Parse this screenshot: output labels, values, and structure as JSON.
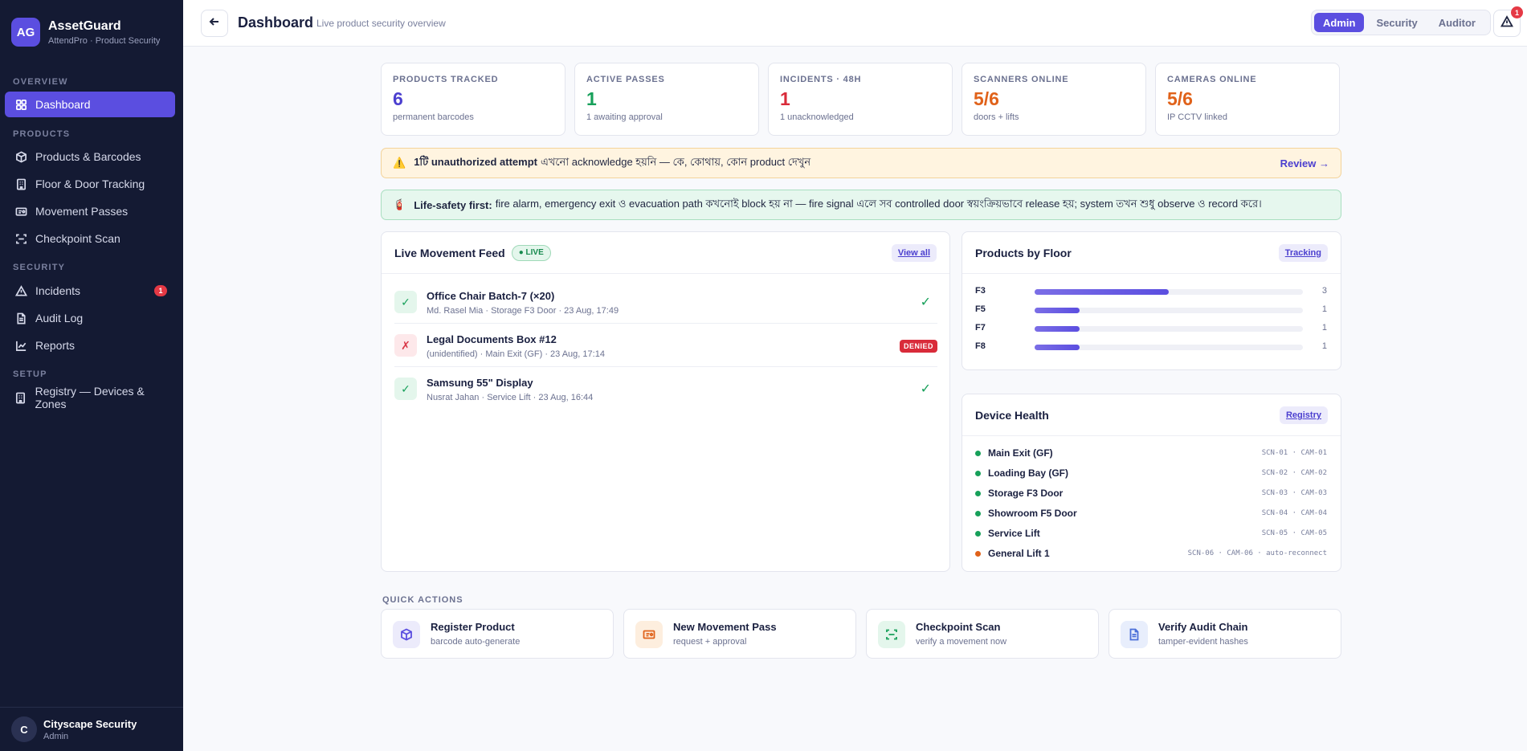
{
  "brand": {
    "logo": "AG",
    "name": "AssetGuard",
    "subtitle": "AttendPro · Product Security"
  },
  "nav": {
    "sections": {
      "overview": "OVERVIEW",
      "products": "PRODUCTS",
      "security": "SECURITY",
      "setup": "SETUP"
    },
    "items": [
      {
        "label": "Dashboard",
        "icon": "grid-icon"
      },
      {
        "label": "Products & Barcodes",
        "icon": "box-icon"
      },
      {
        "label": "Floor & Door Tracking",
        "icon": "building-icon"
      },
      {
        "label": "Movement Passes",
        "icon": "ticket-icon"
      },
      {
        "label": "Checkpoint Scan",
        "icon": "scan-icon"
      },
      {
        "label": "Incidents",
        "icon": "warning-icon",
        "badge": "1"
      },
      {
        "label": "Audit Log",
        "icon": "document-icon"
      },
      {
        "label": "Reports",
        "icon": "chart-icon"
      },
      {
        "label": "Registry — Devices & Zones",
        "icon": "building-icon"
      }
    ]
  },
  "user": {
    "initial": "C",
    "name": "Cityscape Security",
    "role": "Admin"
  },
  "header": {
    "title": "Dashboard",
    "subtitle": "Live product security overview",
    "roles": [
      "Admin",
      "Security",
      "Auditor"
    ],
    "active_role": "Admin",
    "alert_count": "1"
  },
  "stats": [
    {
      "label": "PRODUCTS TRACKED",
      "value": "6",
      "sub": "permanent barcodes",
      "color": "#4b3fcf"
    },
    {
      "label": "ACTIVE PASSES",
      "value": "1",
      "sub": "1 awaiting approval",
      "color": "#17a05a"
    },
    {
      "label": "INCIDENTS · 48H",
      "value": "1",
      "sub": "1 unacknowledged",
      "color": "#d92b3a"
    },
    {
      "label": "SCANNERS ONLINE",
      "value": "5/6",
      "sub": "doors + lifts",
      "color": "#e0621a"
    },
    {
      "label": "CAMERAS ONLINE",
      "value": "5/6",
      "sub": "IP CCTV linked",
      "color": "#e0621a"
    }
  ],
  "banners": {
    "warning": {
      "icon": "⚠️",
      "bold": "1টি unauthorized attempt",
      "text": "এখনো acknowledge হয়নি — কে, কোথায়, কোন product দেখুন",
      "link": "Review →"
    },
    "safety": {
      "icon": "🧯",
      "bold": "Life-safety first:",
      "text": "fire alarm, emergency exit ও evacuation path কখনোই block হয় না — fire signal এলে সব controlled door স্বয়ংক্রিয়ভাবে release হয়; system তখন শুধু observe ও record করে।"
    }
  },
  "feed": {
    "title": "Live Movement Feed",
    "live": "● LIVE",
    "link": "View all",
    "rows": [
      {
        "status": "ok",
        "symbol": "✓",
        "title": "Office Chair Batch-7 (×20)",
        "meta": "Md. Rasel Mia · Storage F3 Door · 23 Aug, 17:49",
        "result": "✓"
      },
      {
        "status": "bad",
        "symbol": "✗",
        "title": "Legal Documents Box #12",
        "meta": "(unidentified) · Main Exit (GF) · 23 Aug, 17:14",
        "result": "DENIED"
      },
      {
        "status": "ok",
        "symbol": "✓",
        "title": "Samsung 55\" Display",
        "meta": "Nusrat Jahan · Service Lift · 23 Aug, 16:44",
        "result": "✓"
      }
    ]
  },
  "floors": {
    "title": "Products by Floor",
    "link": "Tracking",
    "max": 6,
    "rows": [
      {
        "label": "F3",
        "count": 3
      },
      {
        "label": "F5",
        "count": 1
      },
      {
        "label": "F7",
        "count": 1
      },
      {
        "label": "F8",
        "count": 1
      }
    ]
  },
  "devices": {
    "title": "Device Health",
    "link": "Registry",
    "rows": [
      {
        "name": "Main Exit (GF)",
        "ids": "SCN-01 · CAM-01",
        "status_color": "#17a05a"
      },
      {
        "name": "Loading Bay (GF)",
        "ids": "SCN-02 · CAM-02",
        "status_color": "#17a05a"
      },
      {
        "name": "Storage F3 Door",
        "ids": "SCN-03 · CAM-03",
        "status_color": "#17a05a"
      },
      {
        "name": "Showroom F5 Door",
        "ids": "SCN-04 · CAM-04",
        "status_color": "#17a05a"
      },
      {
        "name": "Service Lift",
        "ids": "SCN-05 · CAM-05",
        "status_color": "#17a05a"
      },
      {
        "name": "General Lift 1",
        "ids": "SCN-06 · CAM-06 · auto-reconnect",
        "status_color": "#e0621a"
      }
    ]
  },
  "quick_actions": {
    "label": "QUICK ACTIONS",
    "items": [
      {
        "title": "Register Product",
        "sub": "barcode auto-generate",
        "icon": "box-icon",
        "color": "#5b4ee0",
        "bg": "#ecebfb"
      },
      {
        "title": "New Movement Pass",
        "sub": "request + approval",
        "icon": "ticket-icon",
        "color": "#e0621a",
        "bg": "#fdeede"
      },
      {
        "title": "Checkpoint Scan",
        "sub": "verify a movement now",
        "icon": "scan-icon",
        "color": "#17a05a",
        "bg": "#e4f6ec"
      },
      {
        "title": "Verify Audit Chain",
        "sub": "tamper-evident hashes",
        "icon": "document-icon",
        "color": "#4b6fd8",
        "bg": "#e8eefc"
      }
    ]
  }
}
